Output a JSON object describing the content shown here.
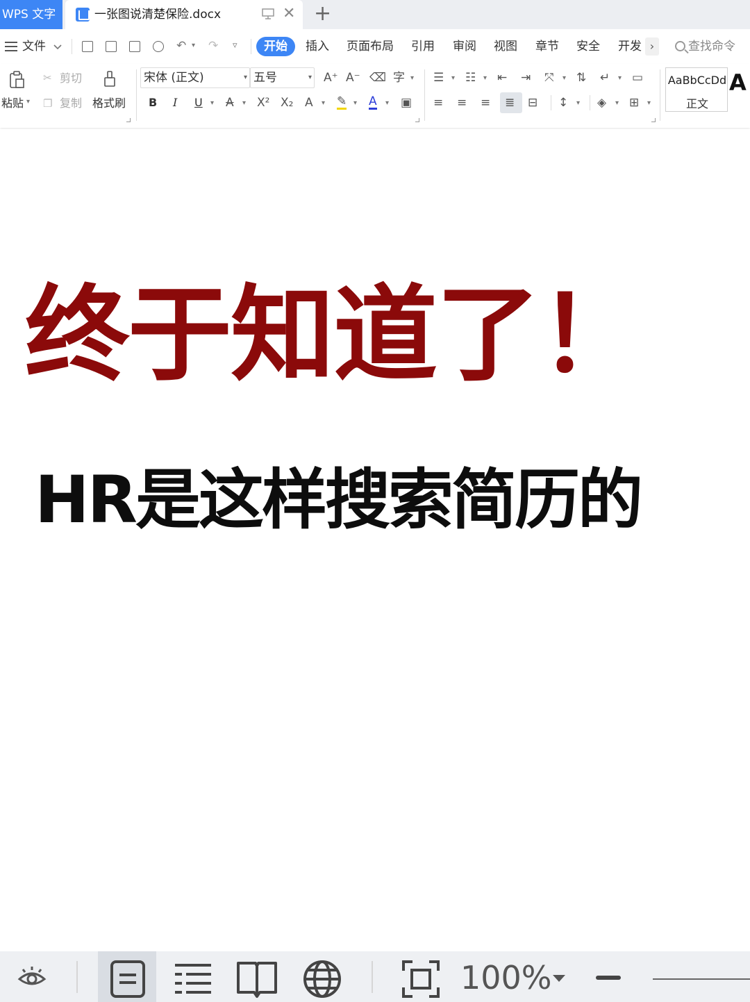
{
  "titlebar": {
    "app_tab": "WPS 文字",
    "document_tab": "一张图说清楚保险.docx",
    "new_tab_glyph": "+",
    "close_glyph": "✕"
  },
  "menu": {
    "file": "文件",
    "tabs": [
      "开始",
      "插入",
      "页面布局",
      "引用",
      "审阅",
      "视图",
      "章节",
      "安全",
      "开发"
    ],
    "more_glyph": "›",
    "search_command": "查找命令"
  },
  "ribbon": {
    "paste": "粘贴",
    "cut": "剪切",
    "copy": "复制",
    "format_painter": "格式刷",
    "font_name": "宋体 (正文)",
    "font_size": "五号",
    "bold": "B",
    "italic": "I",
    "underline": "U",
    "style_sample": "AaBbCcDd",
    "style_name": "正文",
    "style_big": "A"
  },
  "document": {
    "headline": "终于知道了！",
    "subline": "HR是这样搜索简历的"
  },
  "statusbar": {
    "zoom": "100%"
  },
  "colors": {
    "accent": "#3d86f5",
    "headline": "#8b0a0a",
    "subline": "#0d0d0d"
  },
  "icons": [
    "eye-icon",
    "page-view-icon",
    "outline-view-icon",
    "reading-view-icon",
    "web-view-icon",
    "fit-page-icon",
    "zoom-out-icon"
  ]
}
